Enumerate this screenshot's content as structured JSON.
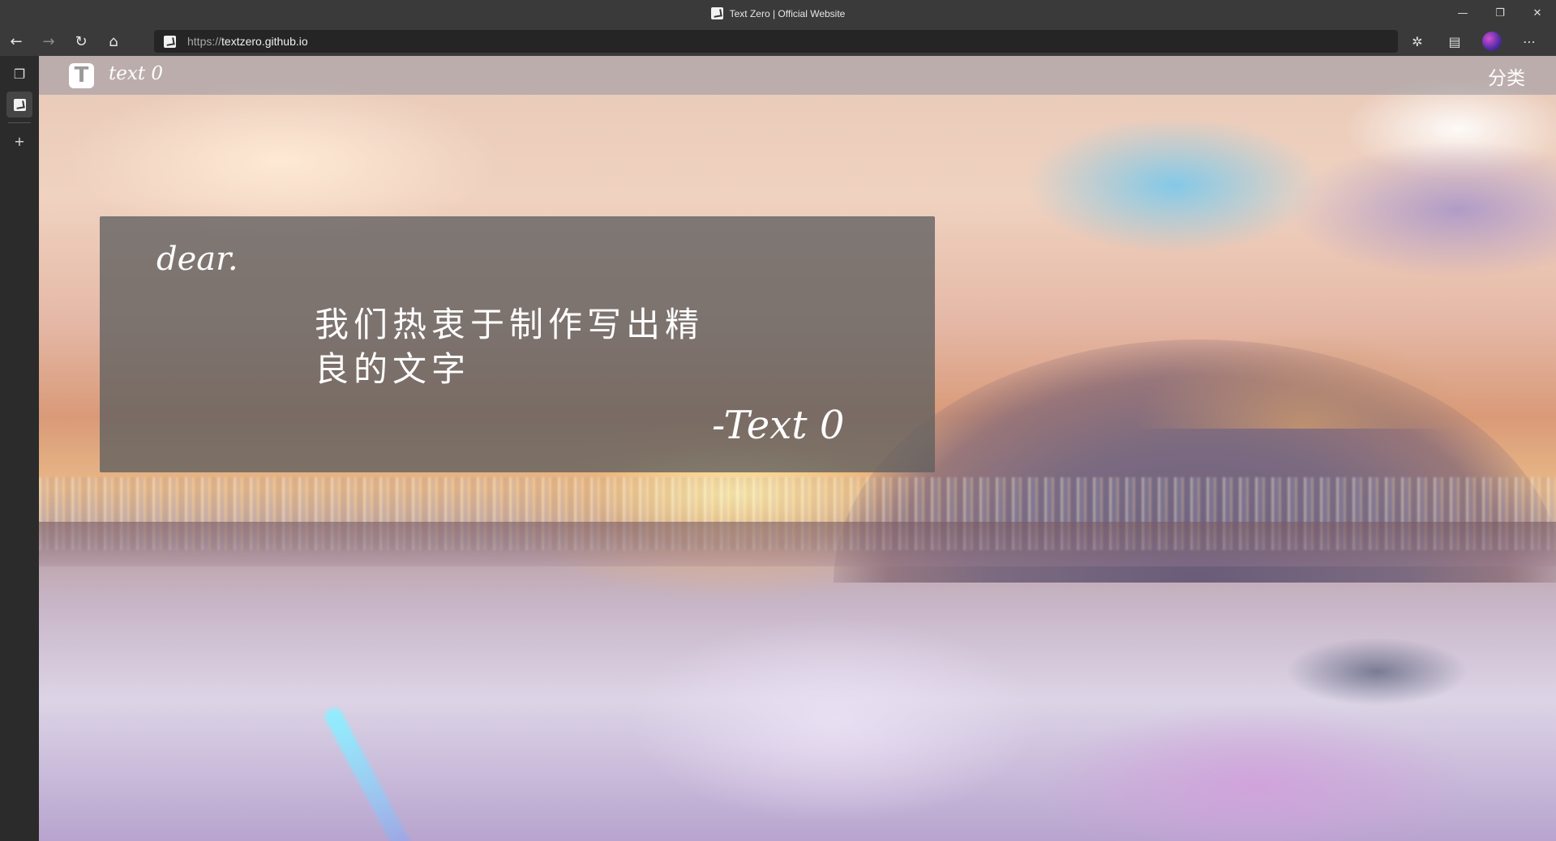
{
  "window": {
    "title": "Text Zero | Official Website",
    "controls": {
      "minimize": "—",
      "restore": "❐",
      "close": "✕"
    }
  },
  "toolbar": {
    "back_icon": "←",
    "forward_icon": "→",
    "refresh_icon": "↻",
    "home_icon": "⌂",
    "url_scheme": "https://",
    "url_host": "textzero.github.io",
    "extensions_icon": "✲",
    "collections_icon": "▤",
    "more_icon": "⋯"
  },
  "sidebar": {
    "tabs_icon": "❐",
    "new_tab_icon": "+"
  },
  "site": {
    "logo_letter": "T",
    "logo_text": "text 0",
    "nav_category": "分类"
  },
  "hero": {
    "greeting": "dear.",
    "line1": "我们热衷于制作写出精",
    "line2": "良的文字",
    "signature": "-Text 0"
  }
}
